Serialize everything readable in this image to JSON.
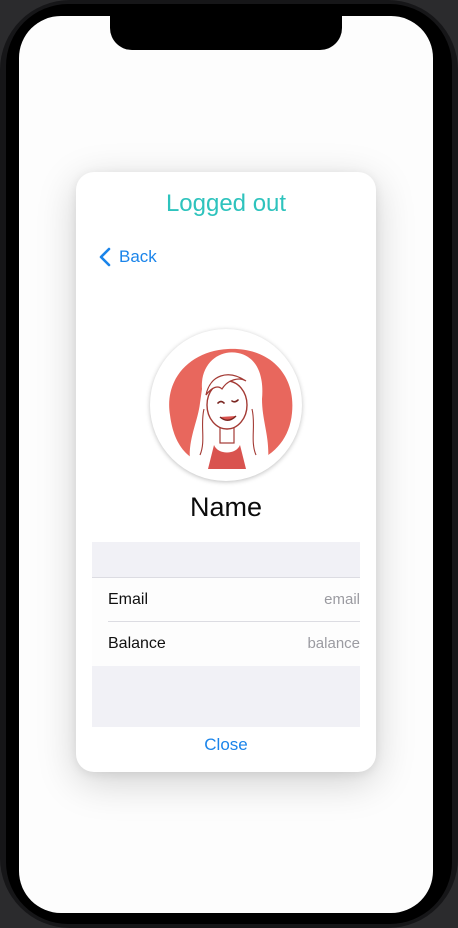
{
  "modal": {
    "title": "Logged out",
    "back_label": "Back",
    "close_label": "Close"
  },
  "profile": {
    "name": "Name",
    "avatar_icon": "woman-cartoon-avatar"
  },
  "details": {
    "rows": [
      {
        "label": "Email",
        "value": "email"
      },
      {
        "label": "Balance",
        "value": "balance"
      }
    ]
  },
  "colors": {
    "title_teal": "#2ec3bd",
    "link_blue": "#1a84ea",
    "avatar_red": "#e8675d"
  }
}
